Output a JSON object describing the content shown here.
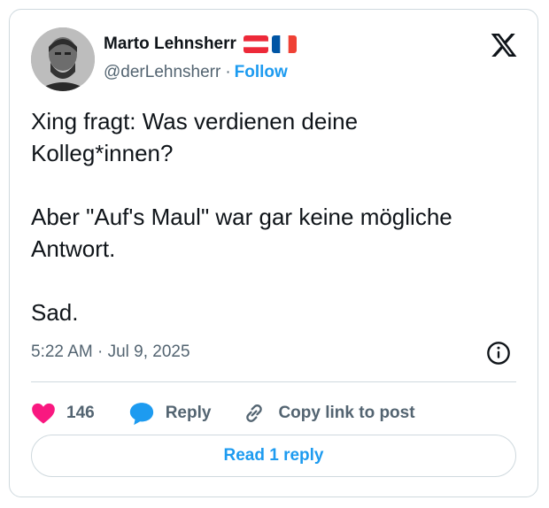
{
  "author": {
    "name": "Marto Lehnsherr",
    "handle": "@derLehnsherr",
    "separator": "·",
    "follow_label": "Follow",
    "flags": [
      "austria-flag",
      "france-flag"
    ]
  },
  "post": {
    "text": "Xing fragt: Was verdienen deine\nKolleg*innen?\n\nAber \"Auf's Maul\" war gar keine mögliche\nAntwort.\n\nSad.",
    "timestamp": "5:22 AM · Jul 9, 2025"
  },
  "actions": {
    "like_count": "146",
    "reply_label": "Reply",
    "copy_label": "Copy link to post"
  },
  "read_replies_label": "Read 1 reply",
  "icons": [
    "x-logo-icon",
    "info-icon",
    "heart-icon",
    "reply-bubble-icon",
    "link-icon"
  ],
  "colors": {
    "accent": "#1d9bf0",
    "heart": "#f91880",
    "secondary_text": "#536471",
    "border": "#cfd9de"
  }
}
